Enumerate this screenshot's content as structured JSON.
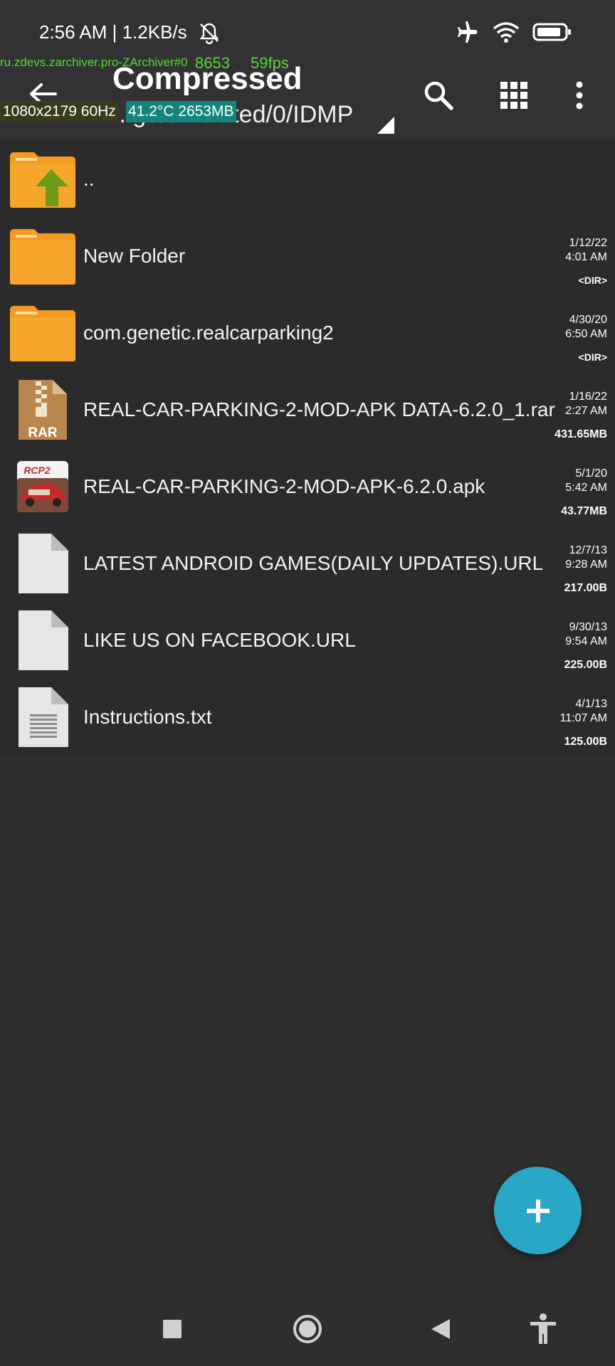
{
  "status_bar": {
    "time_speed": "2:56 AM | 1.2KB/s",
    "icons": [
      "bell-off-icon",
      "airplane-icon",
      "wifi-icon",
      "battery-icon"
    ]
  },
  "debug_overlay": {
    "package": "ru.zdevs.zarchiver.pro-ZArchiver#0",
    "number": "8653",
    "fps": "59fps",
    "resolution": "1080x2179 60Hz",
    "temp_mem": "41.2°C 2653MB"
  },
  "toolbar": {
    "title": "Compressed",
    "path": "...ge/emulated/0/IDMP",
    "icons": [
      "back-arrow-icon",
      "search-icon",
      "grid-view-icon",
      "more-vertical-icon"
    ]
  },
  "files": [
    {
      "name": "..",
      "date": "",
      "time": "",
      "size": "",
      "icon": "folder-up-icon"
    },
    {
      "name": "New Folder",
      "date": "1/12/22",
      "time": "4:01 AM",
      "size": "<DIR>",
      "icon": "folder-icon"
    },
    {
      "name": "com.genetic.realcarparking2",
      "date": "4/30/20",
      "time": "6:50 AM",
      "size": "<DIR>",
      "icon": "folder-icon"
    },
    {
      "name": "REAL-CAR-PARKING-2-MOD-APK DATA-6.2.0_1.rar",
      "date": "1/16/22",
      "time": "2:27 AM",
      "size": "431.65MB",
      "icon": "rar-archive-icon",
      "icon_label": "RAR"
    },
    {
      "name": "REAL-CAR-PARKING-2-MOD-APK-6.2.0.apk",
      "date": "5/1/20",
      "time": "5:42 AM",
      "size": "43.77MB",
      "icon": "apk-app-icon",
      "icon_label": "RCP2"
    },
    {
      "name": "LATEST ANDROID GAMES(DAILY UPDATES).URL",
      "date": "12/7/13",
      "time": "9:28 AM",
      "size": "217.00B",
      "icon": "file-icon"
    },
    {
      "name": "LIKE US ON FACEBOOK.URL",
      "date": "9/30/13",
      "time": "9:54 AM",
      "size": "225.00B",
      "icon": "file-icon"
    },
    {
      "name": "Instructions.txt",
      "date": "4/1/13",
      "time": "11:07 AM",
      "size": "125.00B",
      "icon": "text-file-icon"
    }
  ],
  "fab": {
    "icon": "plus-icon"
  },
  "nav_bar": {
    "icons": [
      "recents-square-icon",
      "home-circle-icon",
      "back-triangle-icon",
      "accessibility-icon"
    ]
  },
  "colors": {
    "background": "#2e2e2f",
    "toolbar": "#323234",
    "row": "#2b2b2c",
    "accent": "#2aa7c7",
    "folder": "#f59a1f",
    "up_arrow": "#6f9a17"
  }
}
